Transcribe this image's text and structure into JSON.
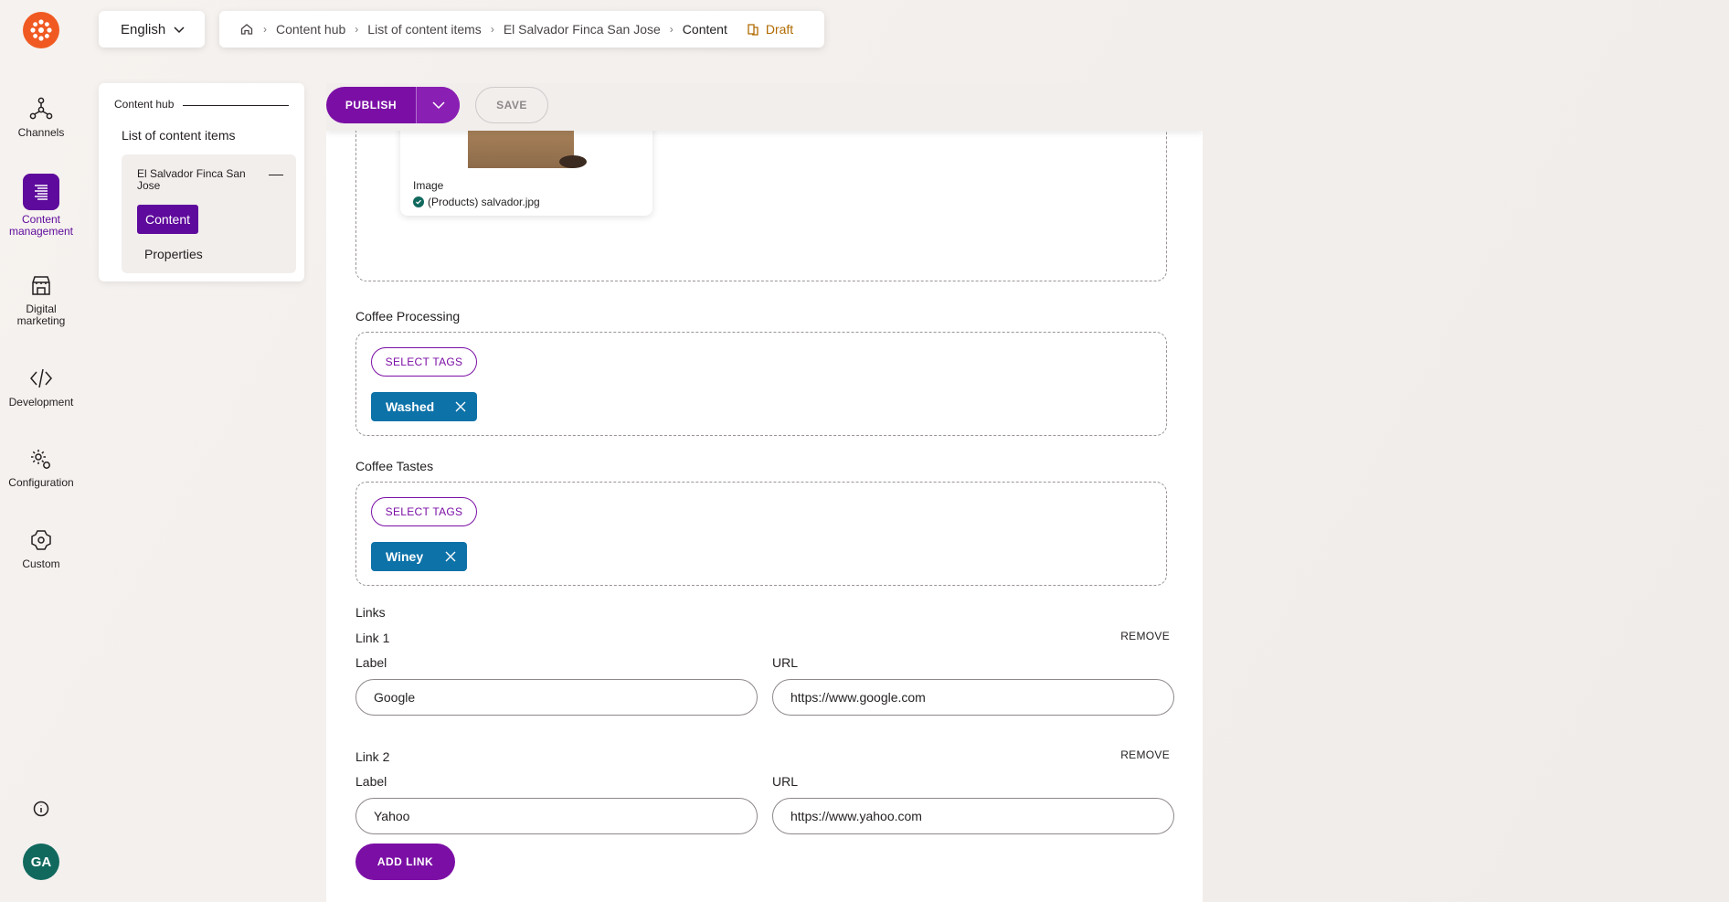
{
  "app": {
    "avatar_initials": "GA",
    "accent_color": "#5e0a9c",
    "brand_color": "#f05a22"
  },
  "rail": {
    "items": [
      {
        "label": "Channels",
        "icon": "channels-icon"
      },
      {
        "label": "Content\nmanagement",
        "icon": "content-management-icon",
        "active": true
      },
      {
        "label": "Digital\nmarketing",
        "icon": "digital-marketing-icon"
      },
      {
        "label": "Development",
        "icon": "development-icon"
      },
      {
        "label": "Configuration",
        "icon": "configuration-icon"
      },
      {
        "label": "Custom",
        "icon": "custom-icon"
      }
    ]
  },
  "language": {
    "selected": "English"
  },
  "breadcrumb": {
    "items": [
      "Content hub",
      "List of content items",
      "El Salvador Finca San Jose",
      "Content"
    ],
    "status": "Draft"
  },
  "subnav": {
    "section": "Content hub",
    "list_label": "List of content items",
    "item_title": "El Salvador Finca San Jose",
    "tabs": [
      "Content",
      "Properties"
    ]
  },
  "actions": {
    "publish": "PUBLISH",
    "save": "SAVE"
  },
  "image_field": {
    "label": "Image",
    "filename": "(Products) salvador.jpg"
  },
  "coffee_processing": {
    "label": "Coffee Processing",
    "select_label": "SELECT TAGS",
    "tags": [
      "Washed"
    ]
  },
  "coffee_tastes": {
    "label": "Coffee Tastes",
    "select_label": "SELECT TAGS",
    "tags": [
      "Winey"
    ]
  },
  "links": {
    "label": "Links",
    "remove_label": "REMOVE",
    "label_caption": "Label",
    "url_caption": "URL",
    "items": [
      {
        "title": "Link 1",
        "label": "Google",
        "url": "https://www.google.com"
      },
      {
        "title": "Link 2",
        "label": "Yahoo",
        "url": "https://www.yahoo.com"
      }
    ],
    "add_label": "ADD LINK"
  }
}
